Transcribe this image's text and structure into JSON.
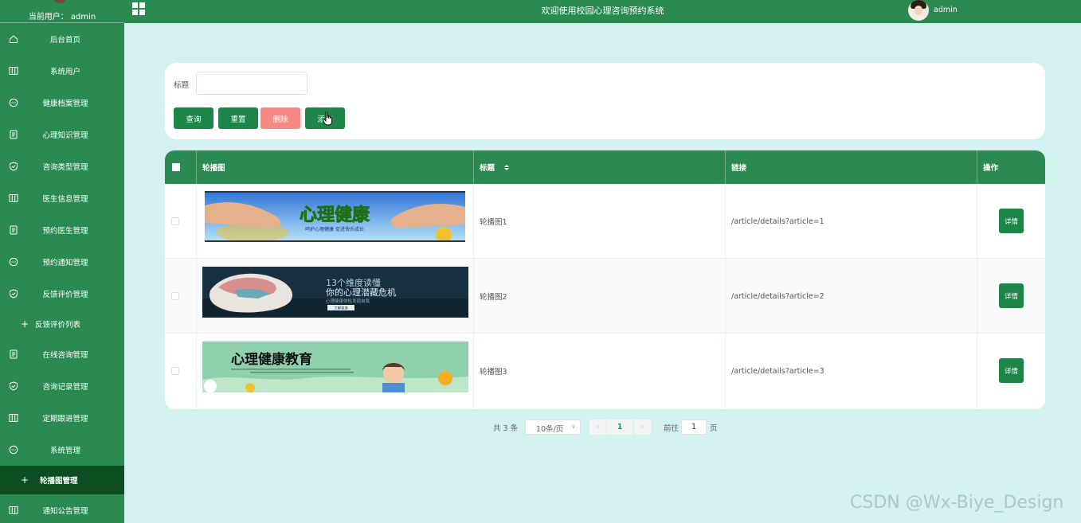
{
  "sidebar": {
    "current_user": "当前用户： admin",
    "items": [
      {
        "label": "后台首页",
        "icon": "home-icon"
      },
      {
        "label": "系统用户",
        "icon": "columns-icon"
      },
      {
        "label": "健康档案管理",
        "icon": "chat-icon"
      },
      {
        "label": "心理知识管理",
        "icon": "document-icon"
      },
      {
        "label": "咨询类型管理",
        "icon": "shield-check-icon"
      },
      {
        "label": "医生信息管理",
        "icon": "columns-icon"
      },
      {
        "label": "预约医生管理",
        "icon": "document-icon"
      },
      {
        "label": "预约通知管理",
        "icon": "chat-icon"
      },
      {
        "label": "反馈评价管理",
        "icon": "shield-check-icon"
      }
    ],
    "sub_feedback": "反馈评价列表",
    "items2": [
      {
        "label": "在线咨询管理",
        "icon": "document-icon"
      },
      {
        "label": "咨询记录管理",
        "icon": "shield-check-icon"
      },
      {
        "label": "定期跟进管理",
        "icon": "columns-icon"
      },
      {
        "label": "系统管理",
        "icon": "chat-icon"
      }
    ],
    "sub_carousel": "轮播图管理",
    "items3": [
      {
        "label": "通知公告管理",
        "icon": "columns-icon"
      }
    ]
  },
  "header": {
    "title": "欢迎使用校园心理咨询预约系统",
    "username": "admin"
  },
  "search": {
    "label": "标题",
    "value": "",
    "query_btn": "查询",
    "reset_btn": "重置",
    "delete_btn": "删除",
    "add_btn": "添加"
  },
  "table": {
    "columns": [
      "轮播图",
      "标题",
      "链接",
      "操作"
    ],
    "detail_label": "详情",
    "rows": [
      {
        "title": "轮播图1",
        "link": "/article/details?article=1",
        "banner_text": "心理健康",
        "banner_sub": "呵护心理健康 促进快乐成长"
      },
      {
        "title": "轮播图2",
        "link": "/article/details?article=2",
        "banner_text_1": "13个维度读懂",
        "banner_text_2": "你的心理潜藏危机",
        "banner_sub": "心理健康体检发现自我",
        "banner_btn": "了解更多"
      },
      {
        "title": "轮播图3",
        "link": "/article/details?article=3",
        "banner_text": "心理健康教育"
      }
    ]
  },
  "pagination": {
    "total": "共 3 条",
    "page_size": "10条/页",
    "current_page": "1",
    "goto_label": "前往",
    "goto_value": "1",
    "page_unit": "页"
  },
  "watermark": "CSDN @Wx-Biye_Design",
  "colors": {
    "primary": "#2a8a52",
    "danger": "#f78884",
    "background": "#d3f1ee",
    "active_menu": "#0a4e22"
  }
}
